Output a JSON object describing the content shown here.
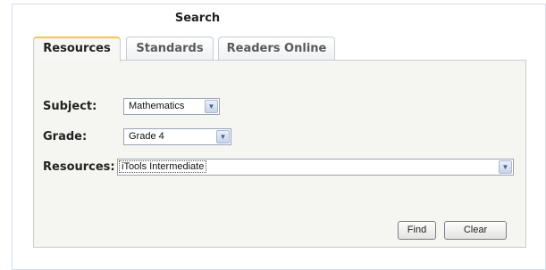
{
  "title": "Search",
  "tabs": [
    {
      "label": "Resources",
      "active": true
    },
    {
      "label": "Standards",
      "active": false
    },
    {
      "label": "Readers Online",
      "active": false
    }
  ],
  "form": {
    "subject": {
      "label": "Subject:",
      "value": "Mathematics"
    },
    "grade": {
      "label": "Grade:",
      "value": "Grade 4"
    },
    "resources": {
      "label": "Resources:",
      "value": "iTools Intermediate"
    }
  },
  "buttons": {
    "find": "Find",
    "clear": "Clear"
  },
  "icons": {
    "dropdown": "chevron-down-icon"
  },
  "colors": {
    "active_tab_accent": "#f3c64d",
    "panel_background": "#f5f5f2",
    "border": "#c9ccd0"
  }
}
